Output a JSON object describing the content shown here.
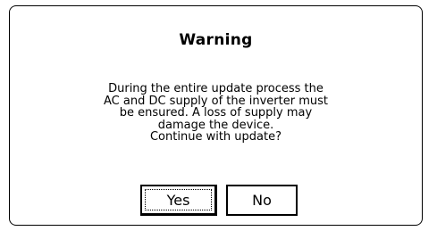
{
  "dialog": {
    "title": "Warning",
    "message_lines": [
      "During the entire update process the",
      "AC and DC supply of the inverter must",
      "be ensured. A loss of supply may",
      "damage the device.",
      "Continue with update?"
    ],
    "buttons": {
      "yes_label": "Yes",
      "no_label": "No"
    }
  }
}
